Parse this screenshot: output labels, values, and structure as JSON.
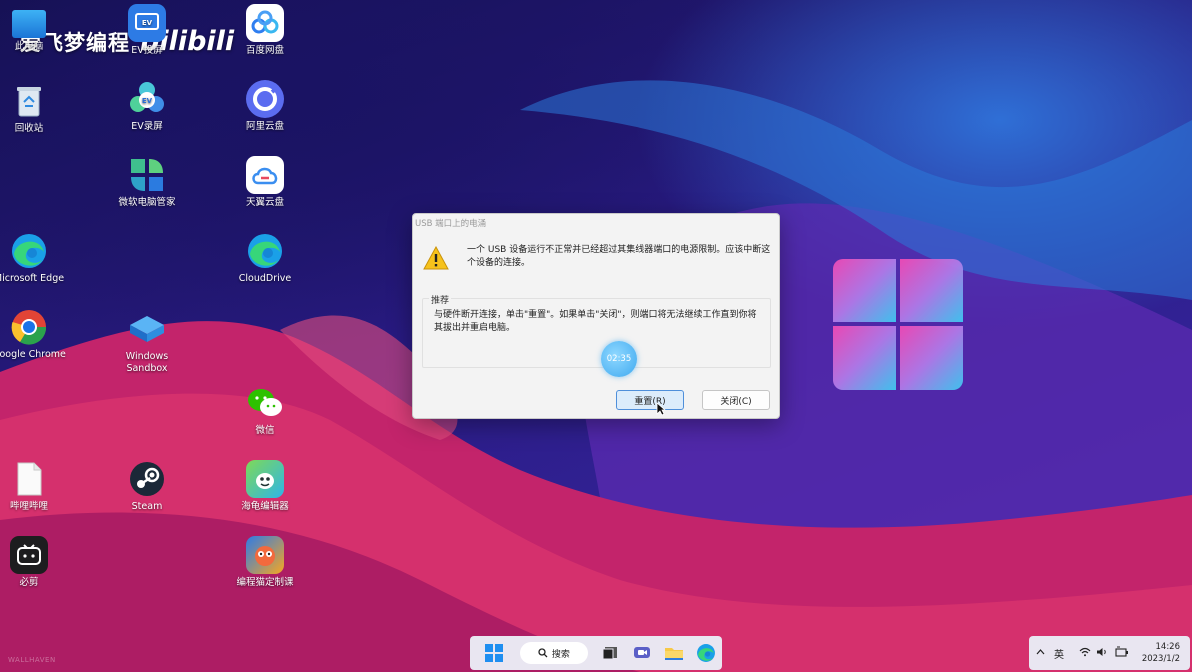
{
  "watermark": {
    "text": "爱飞梦编程",
    "logo": "bilibili"
  },
  "desktop_icons": [
    {
      "id": "this-pc",
      "label": "此电脑",
      "icon": "monitor-icon"
    },
    {
      "id": "recycle",
      "label": "回收站",
      "icon": "recycle-bin-icon"
    },
    {
      "id": "edge",
      "label": "Microsoft Edge",
      "icon": "edge-icon"
    },
    {
      "id": "chrome",
      "label": "Google Chrome",
      "icon": "chrome-icon"
    },
    {
      "id": "bilibili",
      "label": "哔哩哔哩",
      "icon": "file-icon"
    },
    {
      "id": "bijian",
      "label": "必剪",
      "icon": "bijian-icon"
    },
    {
      "id": "ev-cast",
      "label": "EV投屏",
      "icon": "ev-cast-icon"
    },
    {
      "id": "ev-rec",
      "label": "EV录屏",
      "icon": "ev-recorder-icon"
    },
    {
      "id": "pcmgr",
      "label": "微软电脑管家",
      "icon": "pc-manager-icon"
    },
    {
      "id": "sandbox",
      "label": "Windows Sandbox",
      "icon": "sandbox-icon"
    },
    {
      "id": "steam",
      "label": "Steam",
      "icon": "steam-icon"
    },
    {
      "id": "baidu",
      "label": "百度网盘",
      "icon": "baidu-netdisk-icon"
    },
    {
      "id": "aliyun",
      "label": "阿里云盘",
      "icon": "aliyun-drive-icon"
    },
    {
      "id": "tianyi",
      "label": "天翼云盘",
      "icon": "tianyi-cloud-icon"
    },
    {
      "id": "clouddrive",
      "label": "CloudDrive",
      "icon": "clouddrive-icon"
    },
    {
      "id": "wechat",
      "label": "微信",
      "icon": "wechat-icon"
    },
    {
      "id": "turtle",
      "label": "海龟编辑器",
      "icon": "turtle-editor-icon"
    },
    {
      "id": "maoxian",
      "label": "编程猫定制课",
      "icon": "codemao-icon"
    }
  ],
  "dialog": {
    "title": "USB 端口上的电涌",
    "message": "一个 USB 设备运行不正常并已经超过其集线器端口的电源限制。应该中断这个设备的连接。",
    "group_label": "推荐",
    "recommendation": "与硬件断开连接，单击\"重置\"。如果单击\"关闭\"，则端口将无法继续工作直到你将其拔出并重启电脑。",
    "timer": "02:35",
    "reset_label": "重置(R)",
    "close_label": "关闭(C)"
  },
  "taskbar": {
    "search_label": "搜索",
    "apps": [
      "start-icon",
      "task-view-icon",
      "meet-icon",
      "file-explorer-icon",
      "edge-icon"
    ]
  },
  "tray": {
    "ime": "英",
    "time": "14:26",
    "date": "2023/1/2"
  },
  "wallpaper_credit": "WALLHAVEN"
}
